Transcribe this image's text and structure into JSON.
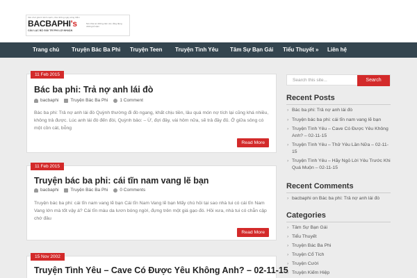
{
  "logo": {
    "tagline": "Sân chơi giải trí lành mạnh, chia những ngày sống thẳm",
    "name_main": "BACBAPHI",
    "name_suffix": "'s",
    "subtitle": "CÂU LẠC BỘ GIẢI TRÍ PHI LỢI NHUẬN",
    "side_text": "Nơi chia sẻ những cảm xúc, lắng đọng những kỉ niệm"
  },
  "nav": {
    "items": [
      "Trang chủ",
      "Truyện Bác Ba Phi",
      "Truyện Teen",
      "Truyện Tình Yêu",
      "Tâm Sự Bạn Gái",
      "Tiểu Thuyết »",
      "Liên hệ"
    ]
  },
  "posts": [
    {
      "date": "11 Feb 2015",
      "title": "Bác ba phi: Trả nợ anh lái đò",
      "author": "bacbaphi",
      "category": "Truyện Bác Ba Phi",
      "comments": "1 Comment",
      "excerpt": "Bác ba phi: Trả nợ anh lái đò Quỳnh thường đi đò ngang, khất chịu tiền, lâu quá món nợ tích lại cũng khá nhiều, không trả được. Lúc anh lái đò đến đòi, Quỳnh bảo: – Ừ, đợi đây, vài hôm nữa, sẽ trả đầy đủ. Ở giữa sông có một cồn cát, bỗng",
      "more": "Read More"
    },
    {
      "date": "11 Feb 2015",
      "title": "Truyện bác ba phi: cái tĩn nam vang lẽ bạn",
      "author": "bacbaphi",
      "category": "Truyện Bác Ba Phi",
      "comments": "0 Comments",
      "excerpt": "Truyện bác ba phi: cái tĩn nam vang lẽ bạn Cái tĩn Nam Vang lẽ bạn Mấy chú hỏi tại sao nhà tui có cái tĩn Nam Vang lớn mà tốt vậy á? Cái tĩn màu da lươn bóng ngời, đựng trên một giá gạo đó. Hồi xưa, nhà tui có chẫn cập chớ đâu",
      "more": "Read More"
    },
    {
      "date": "15 Nov 2002",
      "title": "Truyện Tình Yêu – Cave Có Được Yêu Không Anh? – 02-11-15"
    }
  ],
  "sidebar": {
    "search_placeholder": "Search this site...",
    "search_button": "Search",
    "recent_posts_title": "Recent Posts",
    "recent_posts": [
      "Bác ba phi: Trả nợ anh lái đò",
      "Truyện bác ba phi: cái tĩn nam vang lẽ bạn",
      "Truyện Tình Yêu – Cave Có Được Yêu Không Anh? – 02-11-15",
      "Truyện Tình Yêu – Thử Yêu Lần Nữa – 02-11-15",
      "Truyện Tình Yêu – Hãy Ngỏ Lời Yêu Trước Khi Quá Muộn – 02-11-15"
    ],
    "recent_comments_title": "Recent Comments",
    "recent_comments": [
      "bacbaphi on Bác ba phi: Trả nợ anh lái đò"
    ],
    "categories_title": "Categories",
    "categories": [
      "Tâm Sự Bạn Gái",
      "Tiểu Thuyết",
      "Truyện Bác Ba Phi",
      "Truyện Cổ Tích",
      "Truyện Cười",
      "Truyện Kiếm Hiệp"
    ]
  },
  "colors": {
    "accent": "#d32a2a",
    "nav_bg": "#34454f",
    "page_bg": "#ececec"
  }
}
